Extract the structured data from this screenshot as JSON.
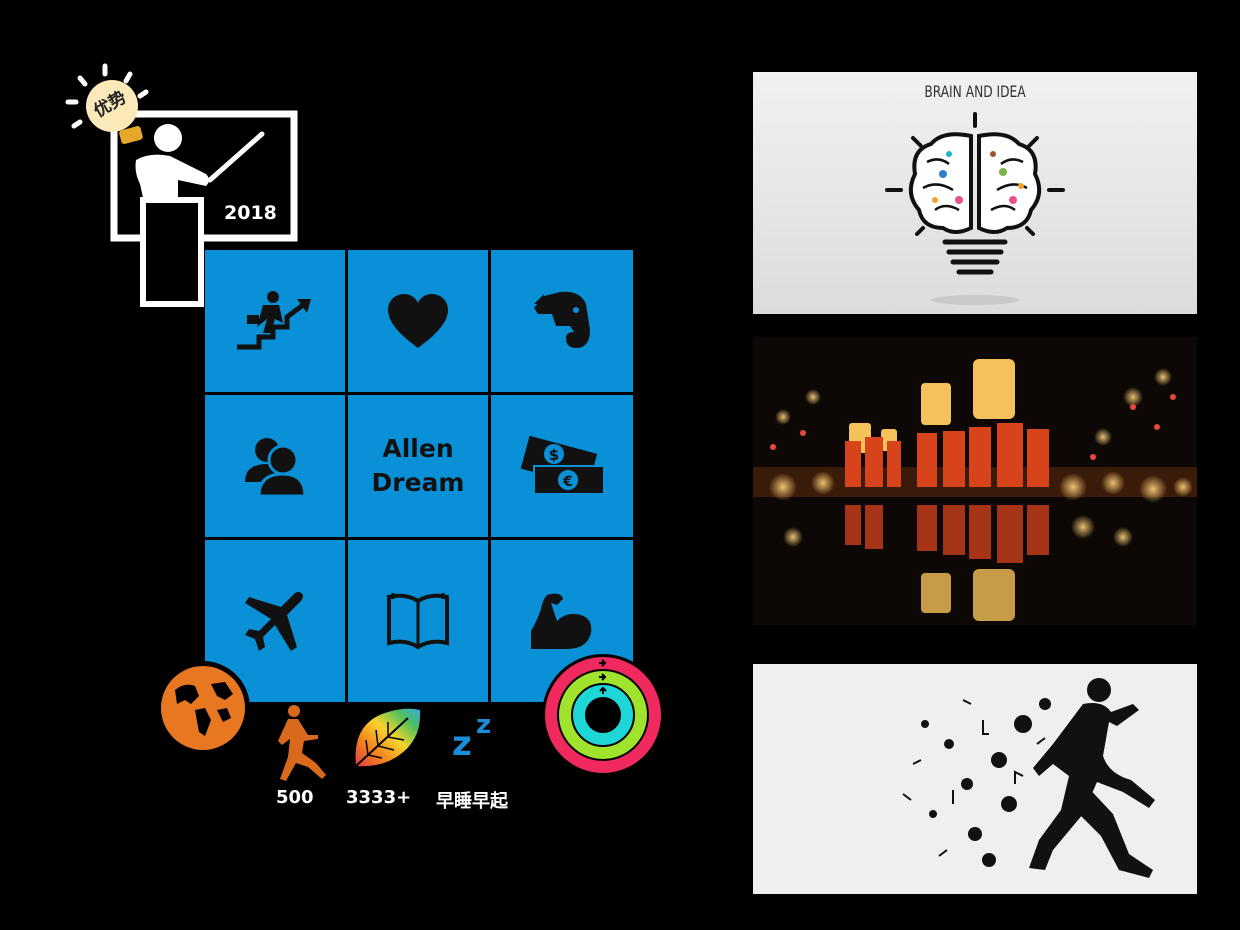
{
  "badge": {
    "label": "优势",
    "year": "2018"
  },
  "grid": {
    "center_line1": "Allen",
    "center_line2": "Dream",
    "tiles": [
      {
        "icon": "running-businessman-icon"
      },
      {
        "icon": "heart-icon"
      },
      {
        "icon": "evernote-elephant-icon"
      },
      {
        "icon": "people-icon"
      },
      {
        "icon": "text"
      },
      {
        "icon": "money-icon"
      },
      {
        "icon": "airplane-icon"
      },
      {
        "icon": "open-book-icon"
      },
      {
        "icon": "flexed-bicep-icon"
      }
    ]
  },
  "stats": {
    "run_count": "500",
    "leaf_count": "3333+",
    "sleep_label": "早睡早起",
    "sleep_glyph": "z z"
  },
  "photos": {
    "brain_title": "BRAIN AND IDEA"
  },
  "colors": {
    "tile_blue": "#0a90d6",
    "globe_orange": "#e87722",
    "runner_orange": "#d9691c",
    "zzz_blue": "#1a8fd8"
  }
}
